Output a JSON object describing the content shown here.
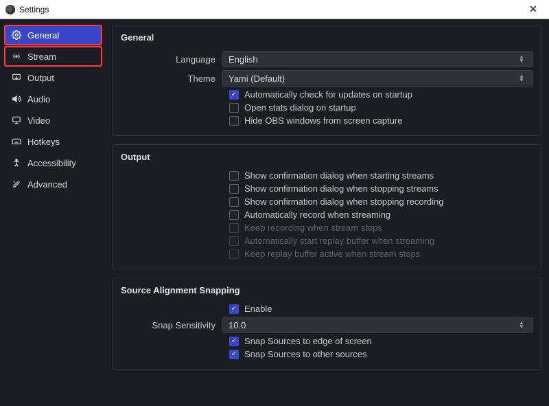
{
  "window": {
    "title": "Settings",
    "close": "✕"
  },
  "sidebar": {
    "items": [
      {
        "label": "General",
        "icon": "gear"
      },
      {
        "label": "Stream",
        "icon": "broadcast"
      },
      {
        "label": "Output",
        "icon": "display-out"
      },
      {
        "label": "Audio",
        "icon": "speaker"
      },
      {
        "label": "Video",
        "icon": "monitor"
      },
      {
        "label": "Hotkeys",
        "icon": "keyboard"
      },
      {
        "label": "Accessibility",
        "icon": "person"
      },
      {
        "label": "Advanced",
        "icon": "tools"
      }
    ]
  },
  "general": {
    "title": "General",
    "language_label": "Language",
    "language_value": "English",
    "theme_label": "Theme",
    "theme_value": "Yami (Default)",
    "auto_update": "Automatically check for updates on startup",
    "open_stats": "Open stats dialog on startup",
    "hide_windows": "Hide OBS windows from screen capture"
  },
  "output": {
    "title": "Output",
    "confirm_start": "Show confirmation dialog when starting streams",
    "confirm_stop": "Show confirmation dialog when stopping streams",
    "confirm_rec_stop": "Show confirmation dialog when stopping recording",
    "auto_record": "Automatically record when streaming",
    "keep_recording": "Keep recording when stream stops",
    "auto_replay": "Automatically start replay buffer when streaming",
    "keep_replay": "Keep replay buffer active when stream stops"
  },
  "snap": {
    "title": "Source Alignment Snapping",
    "enable": "Enable",
    "sensitivity_label": "Snap Sensitivity",
    "sensitivity_value": "10.0",
    "snap_edge": "Snap Sources to edge of screen",
    "snap_other": "Snap Sources to other sources"
  }
}
